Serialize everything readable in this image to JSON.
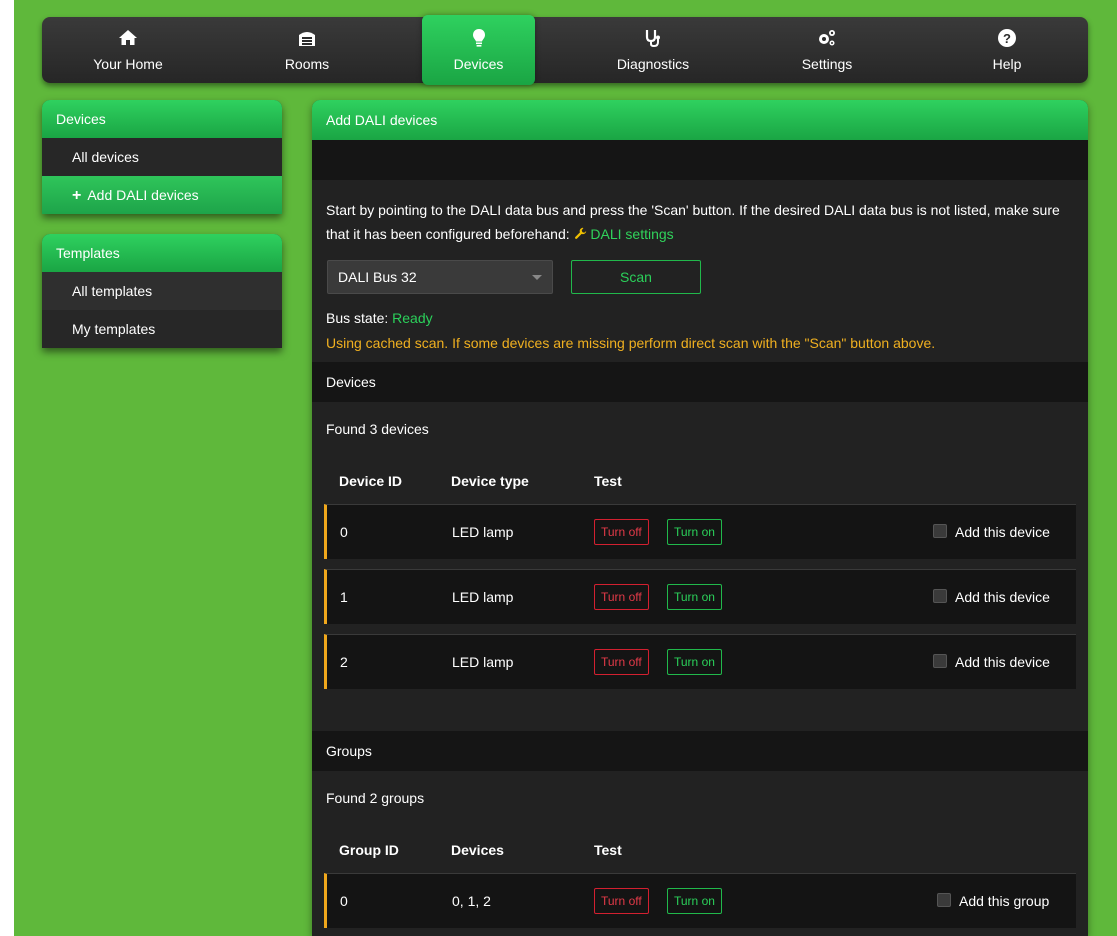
{
  "nav": [
    {
      "label": "Your Home",
      "icon": "home-icon"
    },
    {
      "label": "Rooms",
      "icon": "garage-icon"
    },
    {
      "label": "Devices",
      "icon": "lightbulb-icon",
      "active": true
    },
    {
      "label": "Diagnostics",
      "icon": "stethoscope-icon"
    },
    {
      "label": "Settings",
      "icon": "gears-icon"
    },
    {
      "label": "Help",
      "icon": "question-icon"
    }
  ],
  "sidebar": {
    "devices_panel": {
      "title": "Devices",
      "items": [
        "All devices",
        "Add DALI devices"
      ]
    },
    "templates_panel": {
      "title": "Templates",
      "items": [
        "All templates",
        "My templates"
      ]
    }
  },
  "main": {
    "title": "Add DALI devices",
    "intro": "Start by pointing to the DALI data bus and press the 'Scan' button. If the desired DALI data bus is not listed, make sure that it has been configured beforehand:",
    "settings_link": "DALI settings",
    "bus_select": "DALI Bus 32",
    "scan_label": "Scan",
    "bus_state_label": "Bus state:",
    "bus_state_value": "Ready",
    "warning": "Using cached scan. If some devices are missing perform direct scan with the \"Scan\" button above.",
    "devices": {
      "section_title": "Devices",
      "found": "Found 3 devices",
      "headers": [
        "Device ID",
        "Device type",
        "Test"
      ],
      "rows": [
        {
          "id": "0",
          "type": "LED lamp"
        },
        {
          "id": "1",
          "type": "LED lamp"
        },
        {
          "id": "2",
          "type": "LED lamp"
        }
      ],
      "turn_off": "Turn off",
      "turn_on": "Turn on",
      "add_label": "Add this device"
    },
    "groups": {
      "section_title": "Groups",
      "found": "Found 2 groups",
      "headers": [
        "Group ID",
        "Devices",
        "Test"
      ],
      "rows": [
        {
          "id": "0",
          "devices": "0, 1, 2"
        }
      ],
      "turn_off": "Turn off",
      "turn_on": "Turn on",
      "add_label": "Add this group"
    }
  },
  "colors": {
    "background": "#5fb83b",
    "accent": "#1fb34a",
    "warning": "#f0b020",
    "danger": "#d32030"
  }
}
